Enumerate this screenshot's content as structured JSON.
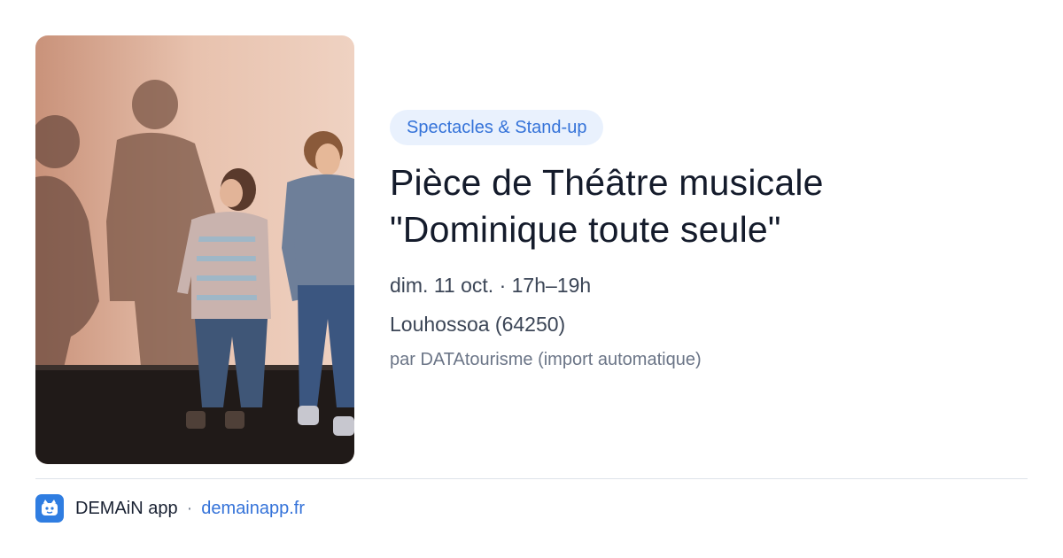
{
  "event": {
    "category": "Spectacles & Stand-up",
    "title_line1": "Pièce de Théâtre musicale",
    "title_line2": "\"Dominique toute seule\"",
    "datetime": "dim. 11 oct. · 17h–19h",
    "location": "Louhossoa (64250)",
    "source": "par DATAtourisme (import automatique)",
    "image_icon": "event-photo"
  },
  "footer": {
    "app_name": "DEMAiN app",
    "separator": "·",
    "domain": "demainapp.fr",
    "logo_icon": "demain-logo-icon"
  },
  "colors": {
    "accent": "#3573d9",
    "badge_bg": "#e9f1fd",
    "logo_bg": "#2f7de1"
  }
}
